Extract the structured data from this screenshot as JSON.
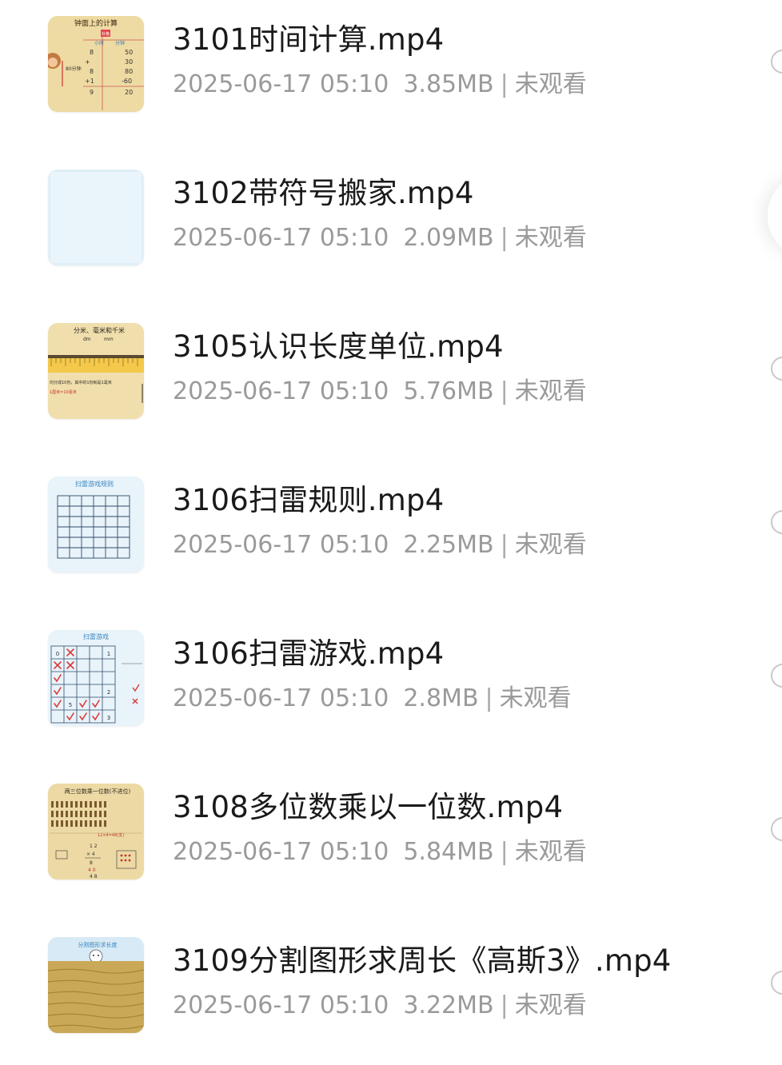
{
  "files": [
    {
      "name": "3101时间计算.mp4",
      "date": "2025-06-17 05:10",
      "size": "3.85MB",
      "separator": "|",
      "status": "未观看",
      "thumb": {
        "bg": "#eedba3",
        "title": "钟面上的计算",
        "note": "80分钟",
        "badge": "补格",
        "col1": "小时",
        "col2": "分钟"
      }
    },
    {
      "name": "3102带符号搬家.mp4",
      "date": "2025-06-17 05:10",
      "size": "2.09MB",
      "separator": "|",
      "status": "未观看",
      "thumb": {
        "bg": "#e4f1f9"
      }
    },
    {
      "name": "3105认识长度单位.mp4",
      "date": "2025-06-17 05:10",
      "size": "5.76MB",
      "separator": "|",
      "status": "未观看",
      "thumb": {
        "bg": "#f0dfad",
        "title": "分米、毫米和千米",
        "sub1": "dm",
        "sub2": "mm",
        "line1": "均分成10份，其中的1份就是1毫米",
        "line2": "1厘米=10毫米"
      }
    },
    {
      "name": "3106扫雷规则.mp4",
      "date": "2025-06-17 05:10",
      "size": "2.25MB",
      "separator": "|",
      "status": "未观看",
      "thumb": {
        "bg": "#e8f3fa",
        "title": "扫雷游戏规则"
      }
    },
    {
      "name": "3106扫雷游戏.mp4",
      "date": "2025-06-17 05:10",
      "size": "2.8MB",
      "separator": "|",
      "status": "未观看",
      "thumb": {
        "bg": "#e8f3fa",
        "title": "扫雷游戏",
        "n1": "1",
        "n2": "2",
        "n3": "5",
        "n4": "3",
        "n5": "0"
      }
    },
    {
      "name": "3108多位数乘以一位数.mp4",
      "date": "2025-06-17 05:10",
      "size": "5.84MB",
      "separator": "|",
      "status": "未观看",
      "thumb": {
        "bg": "#ecd9a4",
        "title": "两三位数乘一位数(不进位)",
        "eq": "12×4=48(支)"
      }
    },
    {
      "name": "3109分割图形求周长《高斯3》.mp4",
      "date": "2025-06-17 05:10",
      "size": "3.22MB",
      "separator": "|",
      "status": "未观看",
      "thumb": {
        "bg": "#d7eaf5",
        "title": "分割图形求长度"
      }
    }
  ],
  "colors": {
    "name_text": "#1a1a1a",
    "meta_text": "#9a9a9a",
    "radio_border": "#c8c8c8"
  }
}
